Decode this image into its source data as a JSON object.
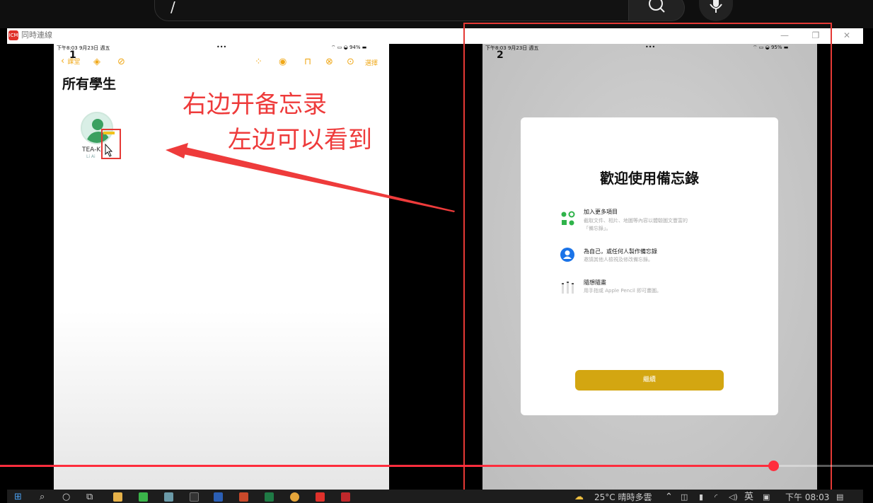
{
  "player": {
    "search_value": "/",
    "search_icon": "search-icon",
    "mic_icon": "mic-icon",
    "progress_fraction": 0.886,
    "progress_color": "#ff2d3d"
  },
  "window": {
    "logo_text": "ICM",
    "title": "同時連線",
    "controls": [
      "—",
      "❐",
      "✕"
    ]
  },
  "left_ipad": {
    "screen_number": "1",
    "status_time": "下午8:03  9月23日 週五",
    "status_dots": "•••",
    "status_right": "⌔ ▭ ◒ 94% ▬",
    "back_label": "課堂",
    "select_label": "選擇",
    "heading": "所有學生",
    "student_name": "TEA-K",
    "student_sub": "Li Ai"
  },
  "right_ipad": {
    "screen_number": "2",
    "status_time": "下午8:03  9月23日 週五",
    "status_dots": "•••",
    "status_right": "⌔ ▭ ◒ 95% ▬",
    "welcome_title": "歡迎使用備忘錄",
    "features": [
      {
        "title": "加入更多項目",
        "sub1": "截取文件、相片、地圖等內容以體驗圖文豐富的",
        "sub2": "「備忘錄」。"
      },
      {
        "title": "為自己，或任何人製作備忘錄",
        "sub1": "邀請其他人檢視及修改備忘錄。",
        "sub2": ""
      },
      {
        "title": "隨想隨畫",
        "sub1": "用手指或 Apple Pencil 即可畫圖。",
        "sub2": ""
      }
    ],
    "continue_label": "繼續"
  },
  "annotations": {
    "line1": "右边开备忘录",
    "line2": "左边可以看到",
    "color": "#ee3b3b"
  },
  "taskbar": {
    "weather": "25°C  晴時多雲",
    "ime": "英",
    "clock": "下午 08:03"
  }
}
